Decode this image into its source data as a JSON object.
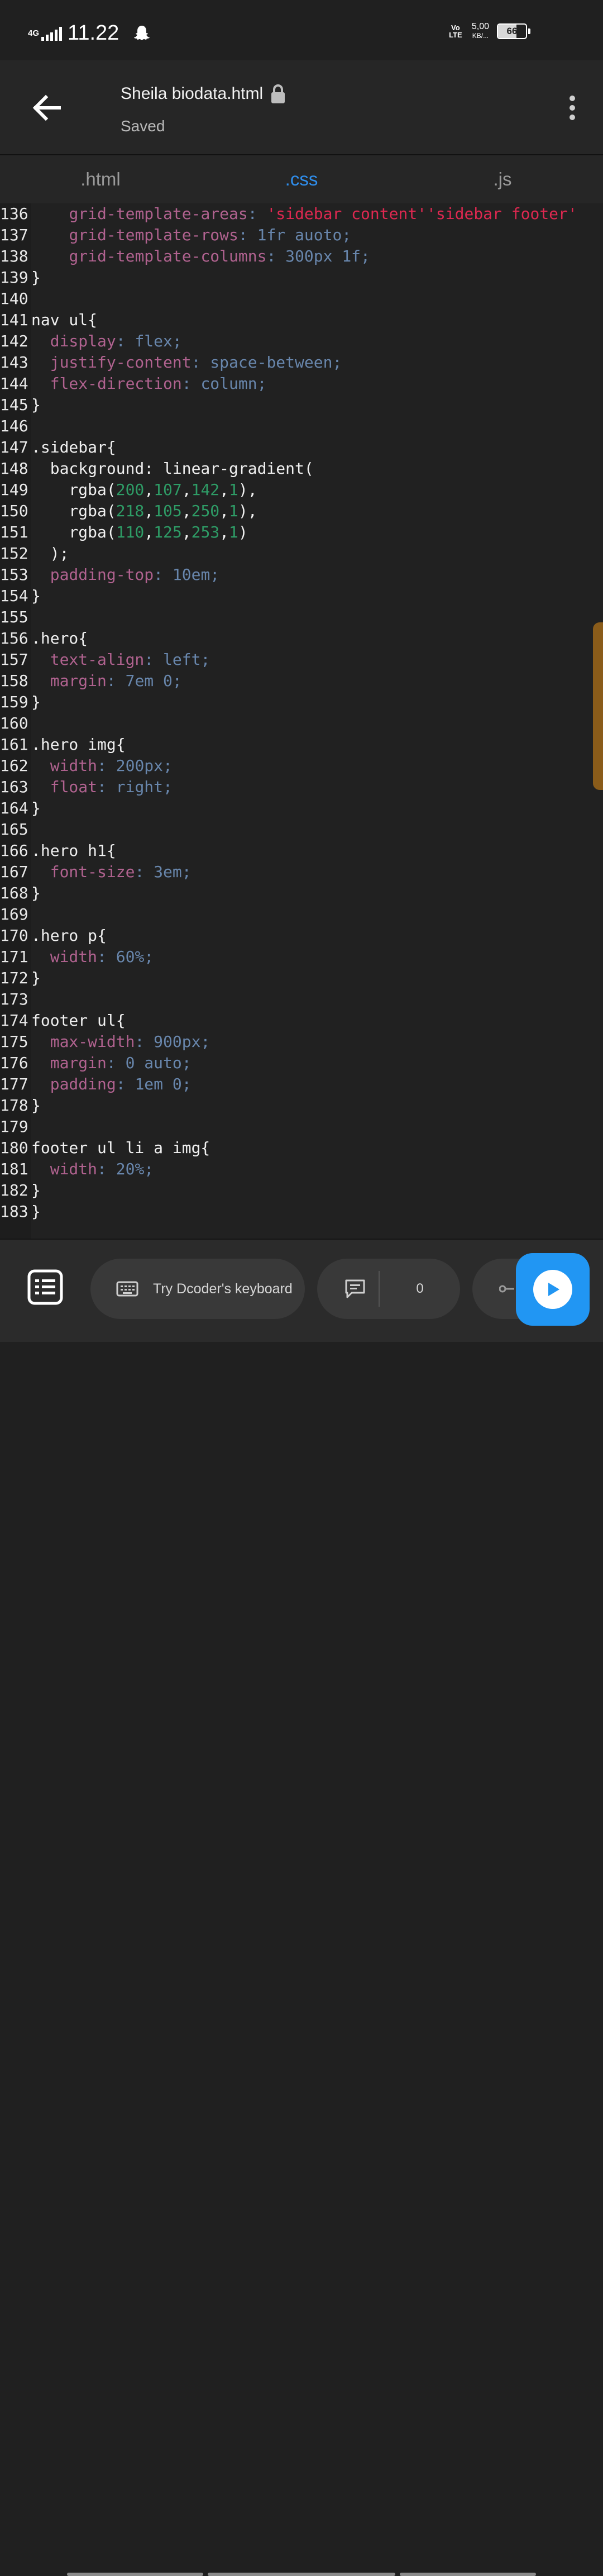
{
  "status_bar": {
    "network": "4G",
    "time": "11.22",
    "volte": "Vo LTE",
    "speed_value": "5,00",
    "speed_unit": "KB/...",
    "battery": "66",
    "battery_level": 66
  },
  "app_bar": {
    "file_name": "Sheila biodata.html",
    "status": "Saved"
  },
  "tabs": [
    {
      "label": ".html",
      "active": false
    },
    {
      "label": ".css",
      "active": true
    },
    {
      "label": ".js",
      "active": false
    }
  ],
  "editor": {
    "lines": [
      {
        "n": "136",
        "parts": [
          {
            "t": "    "
          },
          {
            "t": "grid-template-areas",
            "c": "prop"
          },
          {
            "t": ": ",
            "c": "val"
          },
          {
            "t": "'sidebar content''sidebar footer'",
            "c": "str"
          }
        ]
      },
      {
        "n": "137",
        "parts": [
          {
            "t": "    "
          },
          {
            "t": "grid-template-rows",
            "c": "prop"
          },
          {
            "t": ": 1fr auoto;",
            "c": "val"
          }
        ]
      },
      {
        "n": "138",
        "parts": [
          {
            "t": "    "
          },
          {
            "t": "grid-template-columns",
            "c": "prop"
          },
          {
            "t": ": 300px 1f;",
            "c": "val"
          }
        ]
      },
      {
        "n": "139",
        "parts": [
          {
            "t": "}"
          }
        ]
      },
      {
        "n": "140",
        "parts": []
      },
      {
        "n": "141",
        "parts": [
          {
            "t": "nav ul{"
          }
        ]
      },
      {
        "n": "142",
        "parts": [
          {
            "t": "  "
          },
          {
            "t": "display",
            "c": "prop"
          },
          {
            "t": ": flex;",
            "c": "val"
          }
        ]
      },
      {
        "n": "143",
        "parts": [
          {
            "t": "  "
          },
          {
            "t": "justify-content",
            "c": "prop"
          },
          {
            "t": ": space-between;",
            "c": "val"
          }
        ]
      },
      {
        "n": "144",
        "parts": [
          {
            "t": "  "
          },
          {
            "t": "flex-direction",
            "c": "prop"
          },
          {
            "t": ": column;",
            "c": "val"
          }
        ]
      },
      {
        "n": "145",
        "parts": [
          {
            "t": "}"
          }
        ]
      },
      {
        "n": "146",
        "parts": []
      },
      {
        "n": "147",
        "parts": [
          {
            "t": ".sidebar{"
          }
        ]
      },
      {
        "n": "148",
        "parts": [
          {
            "t": "  background: linear-gradient("
          }
        ]
      },
      {
        "n": "149",
        "parts": [
          {
            "t": "    rgba("
          },
          {
            "t": "200",
            "c": "num"
          },
          {
            "t": ","
          },
          {
            "t": "107",
            "c": "num"
          },
          {
            "t": ","
          },
          {
            "t": "142",
            "c": "num"
          },
          {
            "t": ","
          },
          {
            "t": "1",
            "c": "num"
          },
          {
            "t": "),"
          }
        ]
      },
      {
        "n": "150",
        "parts": [
          {
            "t": "    rgba("
          },
          {
            "t": "218",
            "c": "num"
          },
          {
            "t": ","
          },
          {
            "t": "105",
            "c": "num"
          },
          {
            "t": ","
          },
          {
            "t": "250",
            "c": "num"
          },
          {
            "t": ","
          },
          {
            "t": "1",
            "c": "num"
          },
          {
            "t": "),"
          }
        ]
      },
      {
        "n": "151",
        "parts": [
          {
            "t": "    rgba("
          },
          {
            "t": "110",
            "c": "num"
          },
          {
            "t": ","
          },
          {
            "t": "125",
            "c": "num"
          },
          {
            "t": ","
          },
          {
            "t": "253",
            "c": "num"
          },
          {
            "t": ","
          },
          {
            "t": "1",
            "c": "num"
          },
          {
            "t": ")"
          }
        ]
      },
      {
        "n": "152",
        "parts": [
          {
            "t": "  );"
          }
        ]
      },
      {
        "n": "153",
        "parts": [
          {
            "t": "  "
          },
          {
            "t": "padding-top",
            "c": "prop"
          },
          {
            "t": ": 10em;",
            "c": "val"
          }
        ]
      },
      {
        "n": "154",
        "parts": [
          {
            "t": "}"
          }
        ]
      },
      {
        "n": "155",
        "parts": []
      },
      {
        "n": "156",
        "parts": [
          {
            "t": ".hero{"
          }
        ]
      },
      {
        "n": "157",
        "parts": [
          {
            "t": "  "
          },
          {
            "t": "text-align",
            "c": "prop"
          },
          {
            "t": ": left;",
            "c": "val"
          }
        ]
      },
      {
        "n": "158",
        "parts": [
          {
            "t": "  "
          },
          {
            "t": "margin",
            "c": "prop"
          },
          {
            "t": ": 7em 0;",
            "c": "val"
          }
        ]
      },
      {
        "n": "159",
        "parts": [
          {
            "t": "}"
          }
        ]
      },
      {
        "n": "160",
        "parts": []
      },
      {
        "n": "161",
        "parts": [
          {
            "t": ".hero img{"
          }
        ]
      },
      {
        "n": "162",
        "parts": [
          {
            "t": "  "
          },
          {
            "t": "width",
            "c": "prop"
          },
          {
            "t": ": 200px;",
            "c": "val"
          }
        ]
      },
      {
        "n": "163",
        "parts": [
          {
            "t": "  "
          },
          {
            "t": "float",
            "c": "prop"
          },
          {
            "t": ": right;",
            "c": "val"
          }
        ]
      },
      {
        "n": "164",
        "parts": [
          {
            "t": "}"
          }
        ]
      },
      {
        "n": "165",
        "parts": []
      },
      {
        "n": "166",
        "parts": [
          {
            "t": ".hero h1{"
          }
        ]
      },
      {
        "n": "167",
        "parts": [
          {
            "t": "  "
          },
          {
            "t": "font-size",
            "c": "prop"
          },
          {
            "t": ": 3em;",
            "c": "val"
          }
        ]
      },
      {
        "n": "168",
        "parts": [
          {
            "t": "}"
          }
        ]
      },
      {
        "n": "169",
        "parts": []
      },
      {
        "n": "170",
        "parts": [
          {
            "t": ".hero p{"
          }
        ]
      },
      {
        "n": "171",
        "parts": [
          {
            "t": "  "
          },
          {
            "t": "width",
            "c": "prop"
          },
          {
            "t": ": 60%;",
            "c": "val"
          }
        ]
      },
      {
        "n": "172",
        "parts": [
          {
            "t": "}"
          }
        ]
      },
      {
        "n": "173",
        "parts": []
      },
      {
        "n": "174",
        "parts": [
          {
            "t": "footer ul{"
          }
        ]
      },
      {
        "n": "175",
        "parts": [
          {
            "t": "  "
          },
          {
            "t": "max-width",
            "c": "prop"
          },
          {
            "t": ": 900px;",
            "c": "val"
          }
        ]
      },
      {
        "n": "176",
        "parts": [
          {
            "t": "  "
          },
          {
            "t": "margin",
            "c": "prop"
          },
          {
            "t": ": 0 auto;",
            "c": "val"
          }
        ]
      },
      {
        "n": "177",
        "parts": [
          {
            "t": "  "
          },
          {
            "t": "padding",
            "c": "prop"
          },
          {
            "t": ": 1em 0;",
            "c": "val"
          }
        ]
      },
      {
        "n": "178",
        "parts": [
          {
            "t": "}"
          }
        ]
      },
      {
        "n": "179",
        "parts": []
      },
      {
        "n": "180",
        "parts": [
          {
            "t": "footer ul li a img{"
          }
        ]
      },
      {
        "n": "181",
        "parts": [
          {
            "t": "  "
          },
          {
            "t": "width",
            "c": "prop"
          },
          {
            "t": ": 20%;",
            "c": "val"
          }
        ]
      },
      {
        "n": "182",
        "parts": [
          {
            "t": "}"
          }
        ]
      },
      {
        "n": "183",
        "parts": [
          {
            "t": "}"
          }
        ]
      }
    ]
  },
  "bottom_bar": {
    "keyboard_label": "Try Dcoder's keyboard",
    "comment_count": "0"
  },
  "colors": {
    "accent": "#2196f3",
    "active_tab": "#2f8fee",
    "property": "#b0628f",
    "value": "#6886ac",
    "number": "#2e9c66",
    "string": "#dd2850",
    "scroll_thumb": "#8a5c1a"
  },
  "icons": {
    "back": "arrow-left-icon",
    "lock": "lock-icon",
    "more": "more-vert-icon",
    "files": "list-icon",
    "keyboard": "keyboard-icon",
    "comment": "comment-icon",
    "share": "share-icon",
    "run": "play-icon"
  }
}
